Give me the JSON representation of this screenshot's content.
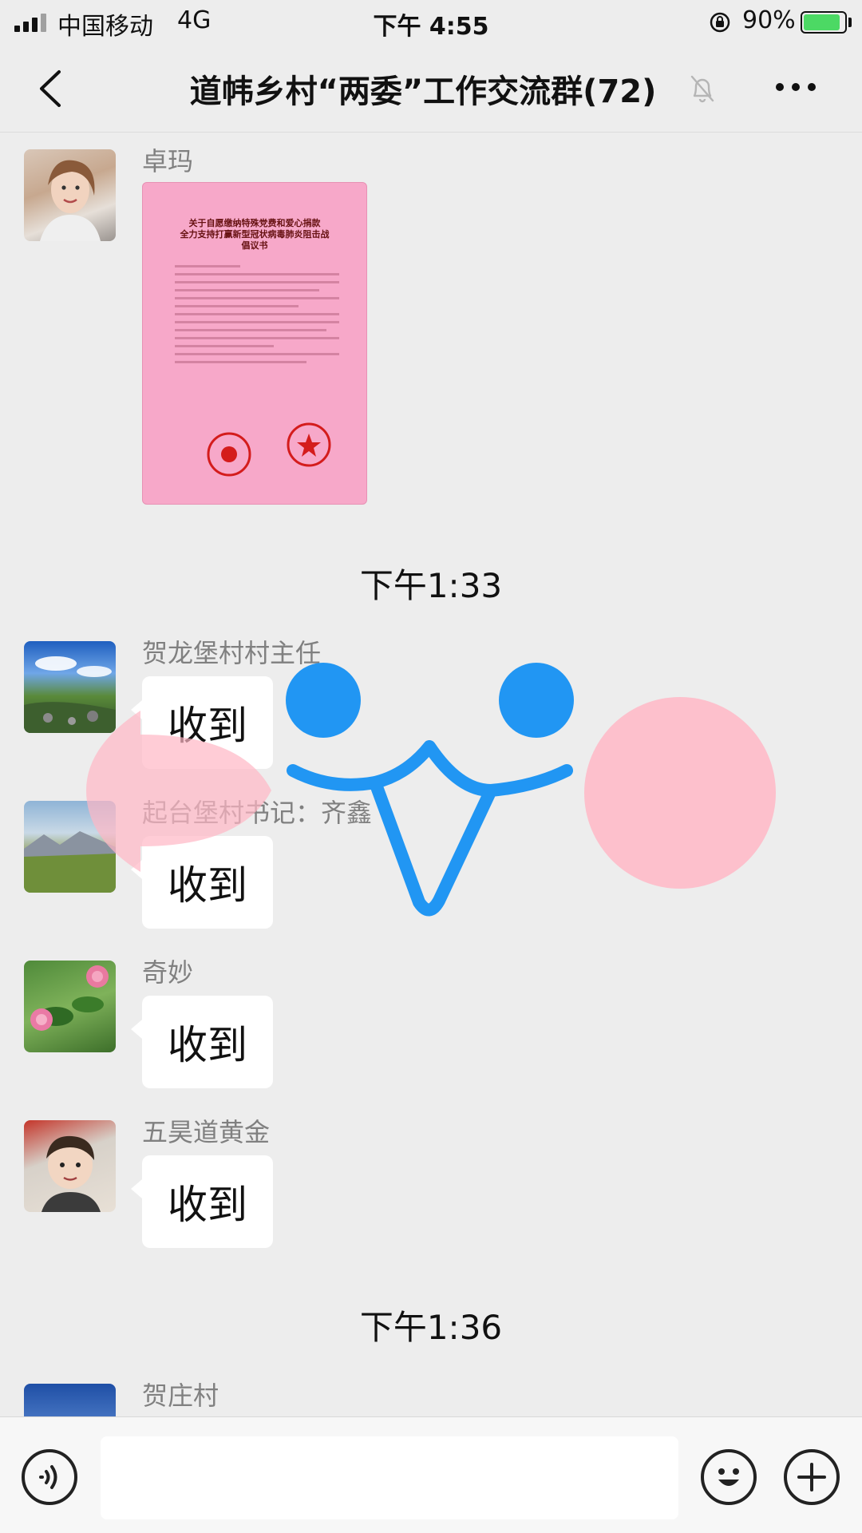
{
  "status_bar": {
    "carrier": "中国移动",
    "network": "4G",
    "time": "下午 4:55",
    "battery_percent": "90%"
  },
  "nav": {
    "title": "道帏乡村“两委”工作交流群(72)",
    "icons": [
      "back-icon",
      "mute-icon",
      "more-icon"
    ]
  },
  "document": {
    "title": "关于自愿缴纳特殊党费和爱心捐款\n全力支持打赢新型冠状病毒肺炎阻击战\n倡议书"
  },
  "messages": [
    {
      "sender": "卓玛",
      "type": "image"
    },
    {
      "time": "下午1:33"
    },
    {
      "sender": "贺龙堡村村主任",
      "text": "收到"
    },
    {
      "sender": "起台堡村书记：齐鑫",
      "text": "收到"
    },
    {
      "sender": "奇妙",
      "text": "收到"
    },
    {
      "sender": "五昊道黄金",
      "text": "收到"
    },
    {
      "time": "下午1:36"
    },
    {
      "sender": "贺庄村",
      "type": "partial"
    }
  ],
  "input_bar": {
    "placeholder": "",
    "icons": [
      "voice-icon",
      "emoji-icon",
      "plus-icon"
    ]
  },
  "colors": {
    "background": "#ededed",
    "bubble": "#ffffff",
    "overlay_blue": "#2196f3",
    "overlay_pink": "#ffb7c5",
    "battery_green": "#4cd964",
    "document_pink": "#f7a8c9"
  }
}
